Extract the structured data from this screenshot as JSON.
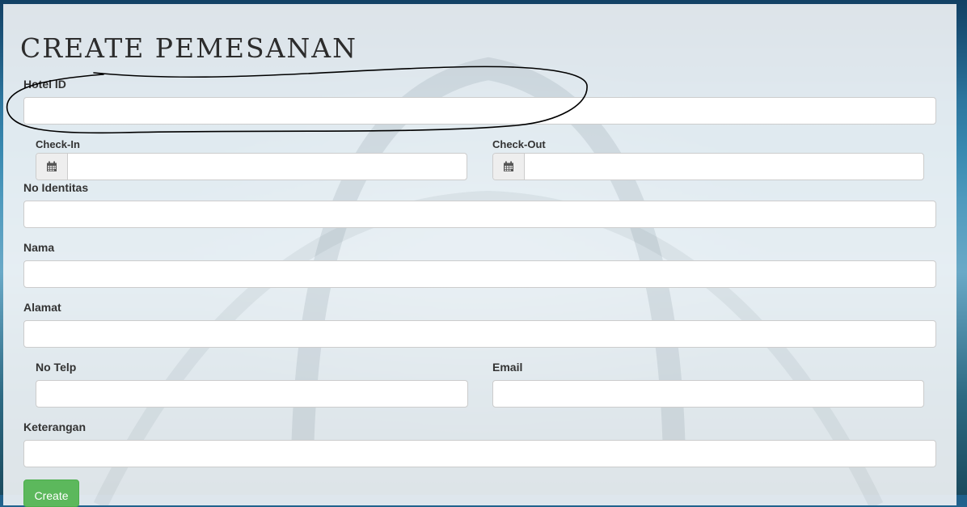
{
  "page": {
    "title": "CREATE PEMESANAN"
  },
  "form": {
    "hotel_id": {
      "label": "Hotel ID",
      "value": ""
    },
    "check_in": {
      "label": "Check-In",
      "value": "",
      "icon": "calendar-icon"
    },
    "check_out": {
      "label": "Check-Out",
      "value": "",
      "icon": "calendar-icon"
    },
    "no_identitas": {
      "label": "No Identitas",
      "value": ""
    },
    "nama": {
      "label": "Nama",
      "value": ""
    },
    "alamat": {
      "label": "Alamat",
      "value": ""
    },
    "no_telp": {
      "label": "No Telp",
      "value": ""
    },
    "email": {
      "label": "Email",
      "value": ""
    },
    "keterangan": {
      "label": "Keterangan",
      "value": ""
    },
    "submit_label": "Create"
  },
  "colors": {
    "primary_button": "#5cb85c",
    "annotation_stroke": "#000000"
  }
}
